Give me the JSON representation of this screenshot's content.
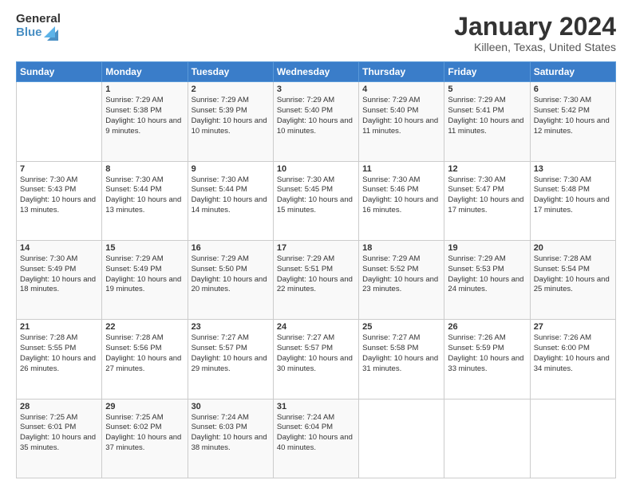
{
  "logo": {
    "line1": "General",
    "line2": "Blue"
  },
  "title": "January 2024",
  "subtitle": "Killeen, Texas, United States",
  "weekdays": [
    "Sunday",
    "Monday",
    "Tuesday",
    "Wednesday",
    "Thursday",
    "Friday",
    "Saturday"
  ],
  "weeks": [
    [
      {
        "day": "",
        "sunrise": "",
        "sunset": "",
        "daylight": ""
      },
      {
        "day": "1",
        "sunrise": "Sunrise: 7:29 AM",
        "sunset": "Sunset: 5:38 PM",
        "daylight": "Daylight: 10 hours and 9 minutes."
      },
      {
        "day": "2",
        "sunrise": "Sunrise: 7:29 AM",
        "sunset": "Sunset: 5:39 PM",
        "daylight": "Daylight: 10 hours and 10 minutes."
      },
      {
        "day": "3",
        "sunrise": "Sunrise: 7:29 AM",
        "sunset": "Sunset: 5:40 PM",
        "daylight": "Daylight: 10 hours and 10 minutes."
      },
      {
        "day": "4",
        "sunrise": "Sunrise: 7:29 AM",
        "sunset": "Sunset: 5:40 PM",
        "daylight": "Daylight: 10 hours and 11 minutes."
      },
      {
        "day": "5",
        "sunrise": "Sunrise: 7:29 AM",
        "sunset": "Sunset: 5:41 PM",
        "daylight": "Daylight: 10 hours and 11 minutes."
      },
      {
        "day": "6",
        "sunrise": "Sunrise: 7:30 AM",
        "sunset": "Sunset: 5:42 PM",
        "daylight": "Daylight: 10 hours and 12 minutes."
      }
    ],
    [
      {
        "day": "7",
        "sunrise": "Sunrise: 7:30 AM",
        "sunset": "Sunset: 5:43 PM",
        "daylight": "Daylight: 10 hours and 13 minutes."
      },
      {
        "day": "8",
        "sunrise": "Sunrise: 7:30 AM",
        "sunset": "Sunset: 5:44 PM",
        "daylight": "Daylight: 10 hours and 13 minutes."
      },
      {
        "day": "9",
        "sunrise": "Sunrise: 7:30 AM",
        "sunset": "Sunset: 5:44 PM",
        "daylight": "Daylight: 10 hours and 14 minutes."
      },
      {
        "day": "10",
        "sunrise": "Sunrise: 7:30 AM",
        "sunset": "Sunset: 5:45 PM",
        "daylight": "Daylight: 10 hours and 15 minutes."
      },
      {
        "day": "11",
        "sunrise": "Sunrise: 7:30 AM",
        "sunset": "Sunset: 5:46 PM",
        "daylight": "Daylight: 10 hours and 16 minutes."
      },
      {
        "day": "12",
        "sunrise": "Sunrise: 7:30 AM",
        "sunset": "Sunset: 5:47 PM",
        "daylight": "Daylight: 10 hours and 17 minutes."
      },
      {
        "day": "13",
        "sunrise": "Sunrise: 7:30 AM",
        "sunset": "Sunset: 5:48 PM",
        "daylight": "Daylight: 10 hours and 17 minutes."
      }
    ],
    [
      {
        "day": "14",
        "sunrise": "Sunrise: 7:30 AM",
        "sunset": "Sunset: 5:49 PM",
        "daylight": "Daylight: 10 hours and 18 minutes."
      },
      {
        "day": "15",
        "sunrise": "Sunrise: 7:29 AM",
        "sunset": "Sunset: 5:49 PM",
        "daylight": "Daylight: 10 hours and 19 minutes."
      },
      {
        "day": "16",
        "sunrise": "Sunrise: 7:29 AM",
        "sunset": "Sunset: 5:50 PM",
        "daylight": "Daylight: 10 hours and 20 minutes."
      },
      {
        "day": "17",
        "sunrise": "Sunrise: 7:29 AM",
        "sunset": "Sunset: 5:51 PM",
        "daylight": "Daylight: 10 hours and 22 minutes."
      },
      {
        "day": "18",
        "sunrise": "Sunrise: 7:29 AM",
        "sunset": "Sunset: 5:52 PM",
        "daylight": "Daylight: 10 hours and 23 minutes."
      },
      {
        "day": "19",
        "sunrise": "Sunrise: 7:29 AM",
        "sunset": "Sunset: 5:53 PM",
        "daylight": "Daylight: 10 hours and 24 minutes."
      },
      {
        "day": "20",
        "sunrise": "Sunrise: 7:28 AM",
        "sunset": "Sunset: 5:54 PM",
        "daylight": "Daylight: 10 hours and 25 minutes."
      }
    ],
    [
      {
        "day": "21",
        "sunrise": "Sunrise: 7:28 AM",
        "sunset": "Sunset: 5:55 PM",
        "daylight": "Daylight: 10 hours and 26 minutes."
      },
      {
        "day": "22",
        "sunrise": "Sunrise: 7:28 AM",
        "sunset": "Sunset: 5:56 PM",
        "daylight": "Daylight: 10 hours and 27 minutes."
      },
      {
        "day": "23",
        "sunrise": "Sunrise: 7:27 AM",
        "sunset": "Sunset: 5:57 PM",
        "daylight": "Daylight: 10 hours and 29 minutes."
      },
      {
        "day": "24",
        "sunrise": "Sunrise: 7:27 AM",
        "sunset": "Sunset: 5:57 PM",
        "daylight": "Daylight: 10 hours and 30 minutes."
      },
      {
        "day": "25",
        "sunrise": "Sunrise: 7:27 AM",
        "sunset": "Sunset: 5:58 PM",
        "daylight": "Daylight: 10 hours and 31 minutes."
      },
      {
        "day": "26",
        "sunrise": "Sunrise: 7:26 AM",
        "sunset": "Sunset: 5:59 PM",
        "daylight": "Daylight: 10 hours and 33 minutes."
      },
      {
        "day": "27",
        "sunrise": "Sunrise: 7:26 AM",
        "sunset": "Sunset: 6:00 PM",
        "daylight": "Daylight: 10 hours and 34 minutes."
      }
    ],
    [
      {
        "day": "28",
        "sunrise": "Sunrise: 7:25 AM",
        "sunset": "Sunset: 6:01 PM",
        "daylight": "Daylight: 10 hours and 35 minutes."
      },
      {
        "day": "29",
        "sunrise": "Sunrise: 7:25 AM",
        "sunset": "Sunset: 6:02 PM",
        "daylight": "Daylight: 10 hours and 37 minutes."
      },
      {
        "day": "30",
        "sunrise": "Sunrise: 7:24 AM",
        "sunset": "Sunset: 6:03 PM",
        "daylight": "Daylight: 10 hours and 38 minutes."
      },
      {
        "day": "31",
        "sunrise": "Sunrise: 7:24 AM",
        "sunset": "Sunset: 6:04 PM",
        "daylight": "Daylight: 10 hours and 40 minutes."
      },
      {
        "day": "",
        "sunrise": "",
        "sunset": "",
        "daylight": ""
      },
      {
        "day": "",
        "sunrise": "",
        "sunset": "",
        "daylight": ""
      },
      {
        "day": "",
        "sunrise": "",
        "sunset": "",
        "daylight": ""
      }
    ]
  ]
}
